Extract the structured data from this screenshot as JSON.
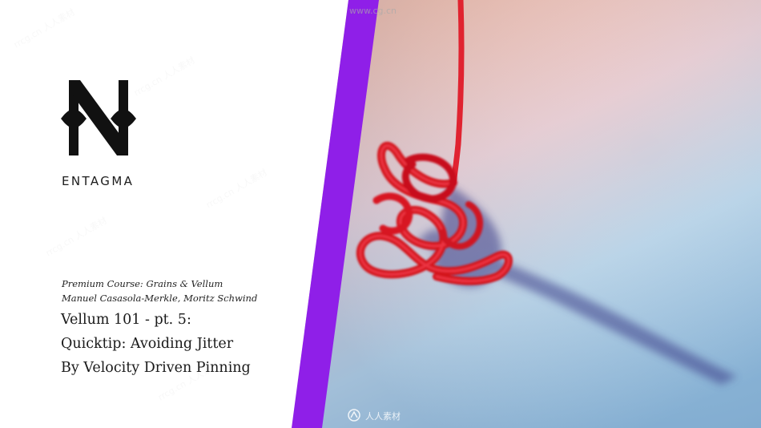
{
  "brand": {
    "logo_icon": "entagma-n-logo-icon",
    "name": "ENTAGMA"
  },
  "course": {
    "line1": "Premium Course: Grains & Vellum",
    "line2": "Manuel Casasola-Merkle, Moritz Schwind"
  },
  "title": {
    "line1": "Vellum 101 - pt. 5:",
    "line2": "Quicktip: Avoiding Jitter",
    "line3": "By Velocity Driven Pinning"
  },
  "watermarks": {
    "top": "www.cg.cn",
    "bottom": "人人素材"
  },
  "colors": {
    "accent_stripe": "#8f1fe8",
    "panel": "#ffffff",
    "text": "#1a1a1a",
    "strand": "#e0182a"
  }
}
